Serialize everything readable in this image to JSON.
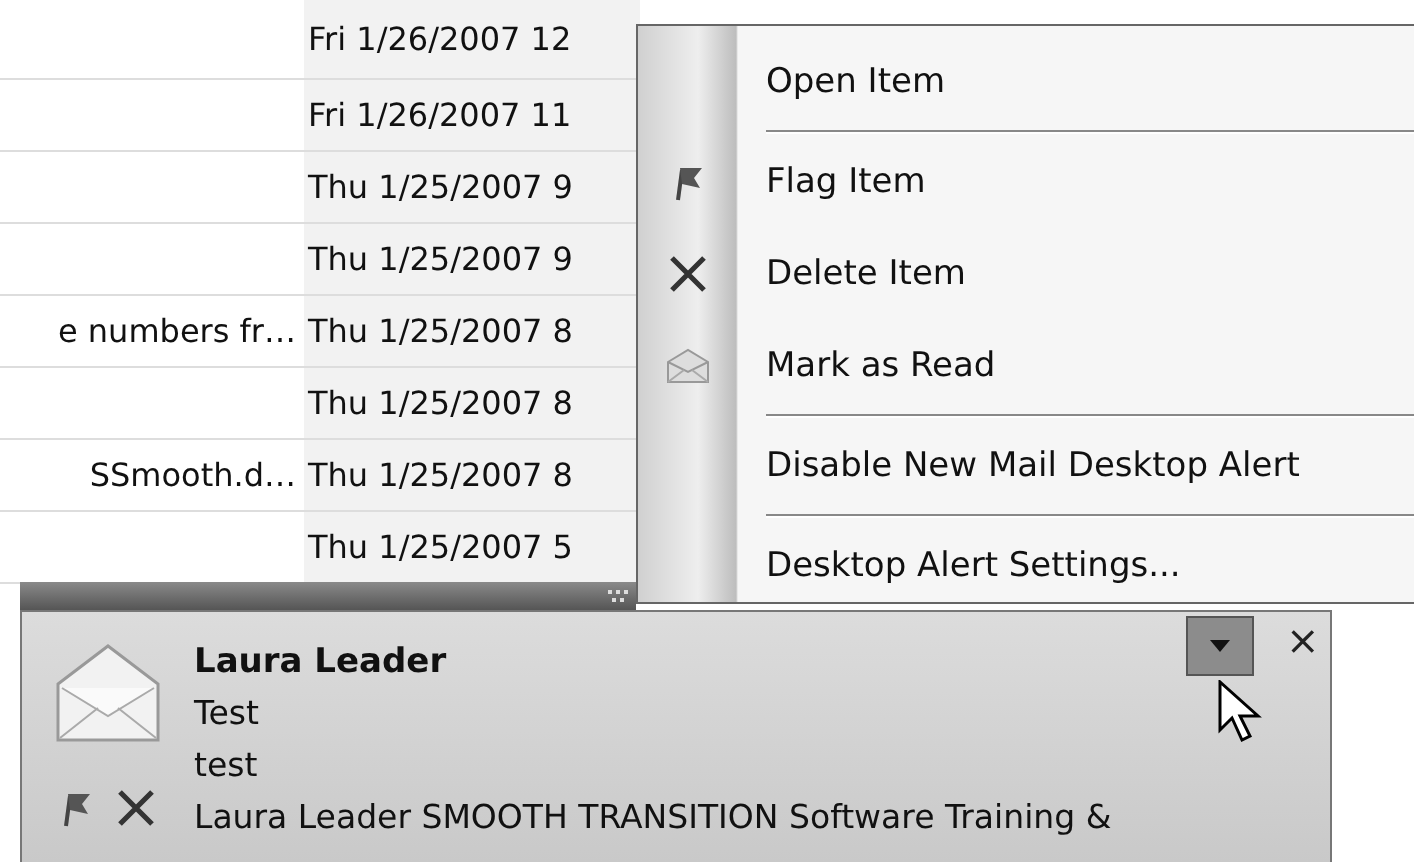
{
  "message_list": {
    "rows": [
      {
        "received": "Fri 1/26/2007 12"
      },
      {
        "received": "Fri 1/26/2007 11"
      },
      {
        "received": "Thu 1/25/2007 9"
      },
      {
        "received": "Thu 1/25/2007 9"
      },
      {
        "subject": "e numbers fr…",
        "received": "Thu 1/25/2007 8"
      },
      {
        "received": "Thu 1/25/2007 8"
      },
      {
        "subject": "SSmooth.d…",
        "received": "Thu 1/25/2007 8"
      },
      {
        "received": "Thu 1/25/2007 5"
      }
    ]
  },
  "context_menu": {
    "items": [
      {
        "kind": "plain",
        "label": "Open Item"
      },
      {
        "kind": "separator"
      },
      {
        "kind": "flag",
        "label": "Flag Item"
      },
      {
        "kind": "delete",
        "label": "Delete Item"
      },
      {
        "kind": "read",
        "label": "Mark as Read"
      },
      {
        "kind": "separator"
      },
      {
        "kind": "plain",
        "label": "Disable New Mail Desktop Alert"
      },
      {
        "kind": "separator"
      },
      {
        "kind": "plain",
        "label": "Desktop Alert Settings..."
      }
    ]
  },
  "desktop_alert": {
    "sender": "Laura Leader",
    "subject": "Test",
    "body_preview": "test",
    "description": "Laura Leader SMOOTH TRANSITION Software Training &",
    "close": "×"
  }
}
